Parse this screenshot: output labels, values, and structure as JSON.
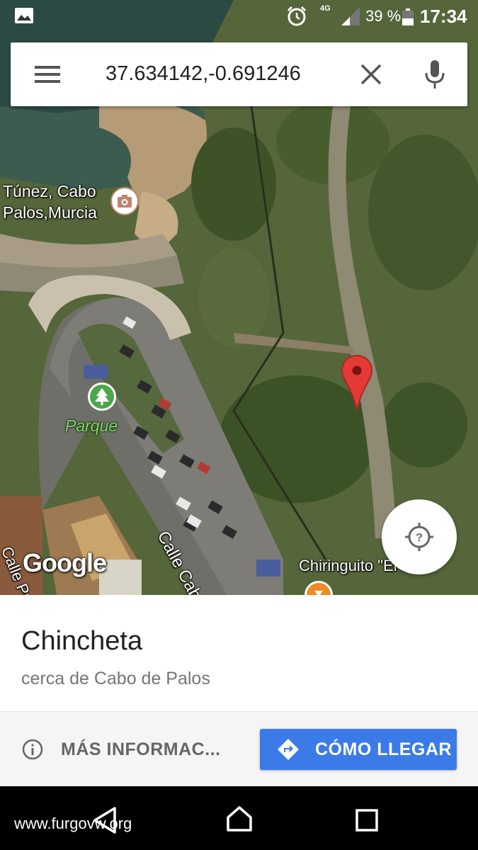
{
  "status_bar": {
    "network": "4G",
    "battery_percent": "39 %",
    "time": "17:34",
    "icons": [
      "image-notification-icon",
      "alarm-icon",
      "signal-icon",
      "battery-icon"
    ]
  },
  "search": {
    "query": "37.634142,-0.691246",
    "icons": [
      "menu-icon",
      "close-icon",
      "mic-icon"
    ]
  },
  "map": {
    "place_label": "Túnez, Cabo Palos,Murcia",
    "park_label": "Parque",
    "street_label": "Calle Cabo Falcón",
    "street_label_2": "Calle Pur",
    "poi_label": "Chiringuito \"El Faro\"",
    "logo": "Google",
    "pin_color": "#e53935"
  },
  "place": {
    "title": "Chincheta",
    "subtitle": "cerca de Cabo de Palos"
  },
  "actions": {
    "more_info": "MÁS INFORMAC...",
    "directions": "CÓMO LLEGAR",
    "directions_color": "#3b7be8"
  },
  "watermark": "www.furgovw.org"
}
